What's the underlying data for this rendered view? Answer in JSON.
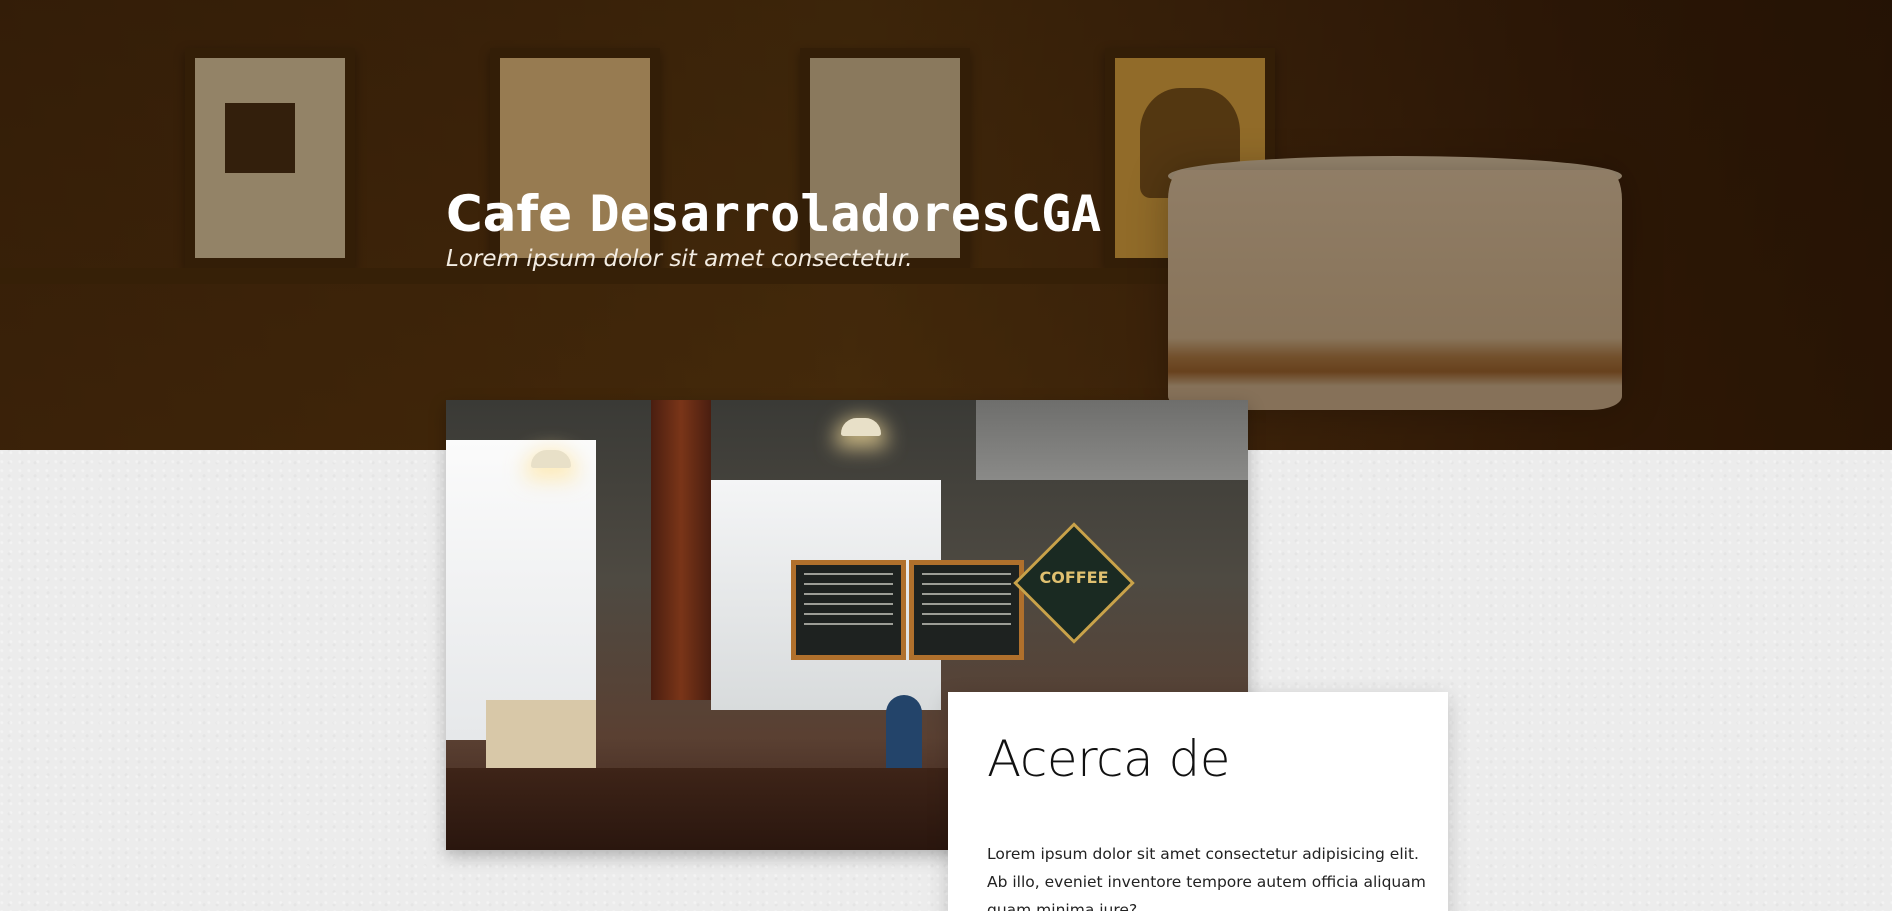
{
  "hero": {
    "title_part1": "Cafe",
    "title_part2": "DesarroladoresCGA",
    "subtitle": "Lorem ipsum dolor sit amet consectetur."
  },
  "photo": {
    "coffee_sign_text": "COFFEE"
  },
  "about": {
    "heading": "Acerca de",
    "body": "Lorem ipsum dolor sit amet consectetur adipisicing elit. Ab illo, eveniet inventore tempore autem officia aliquam quam minima iure?"
  },
  "colors": {
    "hero_dark": "#2a1705",
    "hero_warm": "#7a5416",
    "page_bg": "#ececec",
    "card_bg": "#ffffff",
    "title_text": "#ffffff"
  }
}
